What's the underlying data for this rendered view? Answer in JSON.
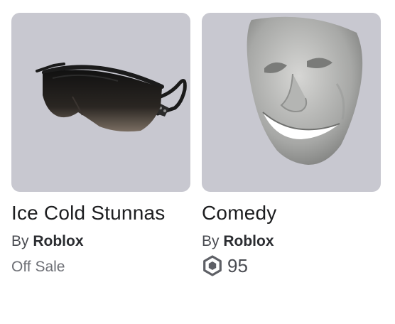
{
  "items": [
    {
      "name": "Ice Cold Stunnas",
      "by_label": "By",
      "creator": "Roblox",
      "status": "Off Sale",
      "thumbnail_icon": "sunglasses-icon"
    },
    {
      "name": "Comedy",
      "by_label": "By",
      "creator": "Roblox",
      "price": "95",
      "currency_icon": "robux-icon",
      "thumbnail_icon": "comedy-mask-icon"
    }
  ],
  "colors": {
    "thumbnail_bg": "#c8c8d0",
    "text_primary": "#1d1e20",
    "text_secondary": "#4a4c52",
    "text_muted": "#6d6f75"
  }
}
